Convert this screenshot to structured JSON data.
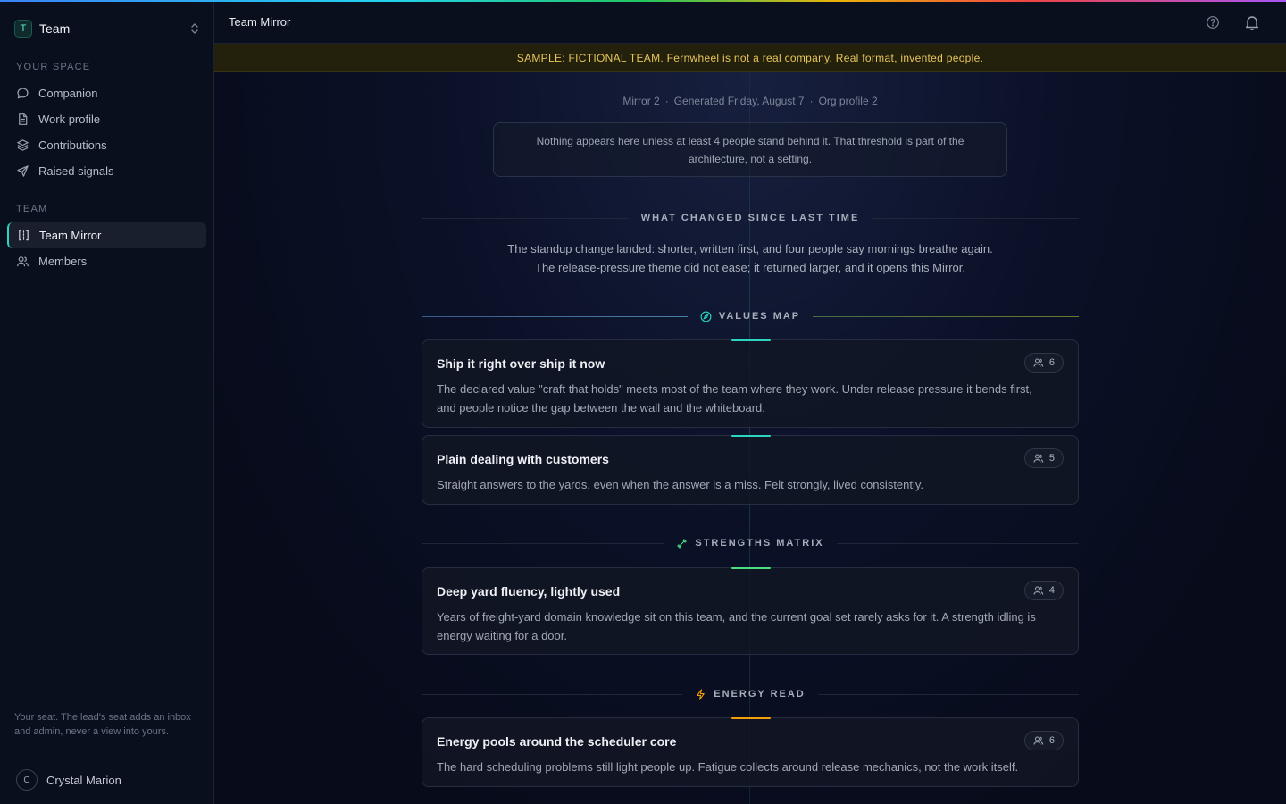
{
  "sidebar": {
    "team_switcher": {
      "avatar_letter": "T",
      "name": "Team"
    },
    "your_space_heading": "YOUR SPACE",
    "your_space_items": [
      {
        "label": "Companion",
        "icon": "chat-bubble-icon"
      },
      {
        "label": "Work profile",
        "icon": "document-icon"
      },
      {
        "label": "Contributions",
        "icon": "layers-icon"
      },
      {
        "label": "Raised signals",
        "icon": "send-icon"
      }
    ],
    "team_heading": "TEAM",
    "team_items": [
      {
        "label": "Team Mirror",
        "icon": "mirror-frame-icon",
        "active": true
      },
      {
        "label": "Members",
        "icon": "users-icon",
        "active": false
      }
    ],
    "seat_note": "Your seat. The lead's seat adds an inbox and admin, never a view into yours.",
    "user": {
      "initial": "C",
      "name": "Crystal Marion"
    }
  },
  "topbar": {
    "title": "Team Mirror"
  },
  "banner": {
    "text": "SAMPLE: FICTIONAL TEAM. Fernwheel is not a real company. Real format, invented people."
  },
  "meta": {
    "mirror": "Mirror 2",
    "generated": "Generated Friday, August 7",
    "org_profile": "Org profile 2"
  },
  "threshold_note": "Nothing appears here unless at least 4 people stand behind it. That threshold is part of the architecture, not a setting.",
  "sections": {
    "changed": {
      "label": "WHAT CHANGED SINCE LAST TIME",
      "line1": "The standup change landed: shorter, written first, and four people say mornings breathe again.",
      "line2": "The release-pressure theme did not ease; it returned larger, and it opens this Mirror."
    },
    "values": {
      "label": "VALUES MAP",
      "icon": "compass-icon",
      "cards": [
        {
          "title": "Ship it right over ship it now",
          "count": "6",
          "body": "The declared value \"craft that holds\" meets most of the team where they work. Under release pressure it bends first, and people notice the gap between the wall and the whiteboard."
        },
        {
          "title": "Plain dealing with customers",
          "count": "5",
          "body": "Straight answers to the yards, even when the answer is a miss. Felt strongly, lived consistently."
        }
      ]
    },
    "strengths": {
      "label": "STRENGTHS MATRIX",
      "icon": "dumbbell-icon",
      "cards": [
        {
          "title": "Deep yard fluency, lightly used",
          "count": "4",
          "body": "Years of freight-yard domain knowledge sit on this team, and the current goal set rarely asks for it. A strength idling is energy waiting for a door."
        }
      ]
    },
    "energy": {
      "label": "ENERGY READ",
      "icon": "lightning-icon",
      "cards": [
        {
          "title": "Energy pools around the scheduler core",
          "count": "6",
          "body": "The hard scheduling problems still light people up. Fatigue collects around release mechanics, not the work itself."
        }
      ]
    }
  },
  "colors": {
    "teal_accent": "#2dd4bf",
    "amber_accent": "#f59e0b",
    "banner_text": "#e7c65a"
  }
}
